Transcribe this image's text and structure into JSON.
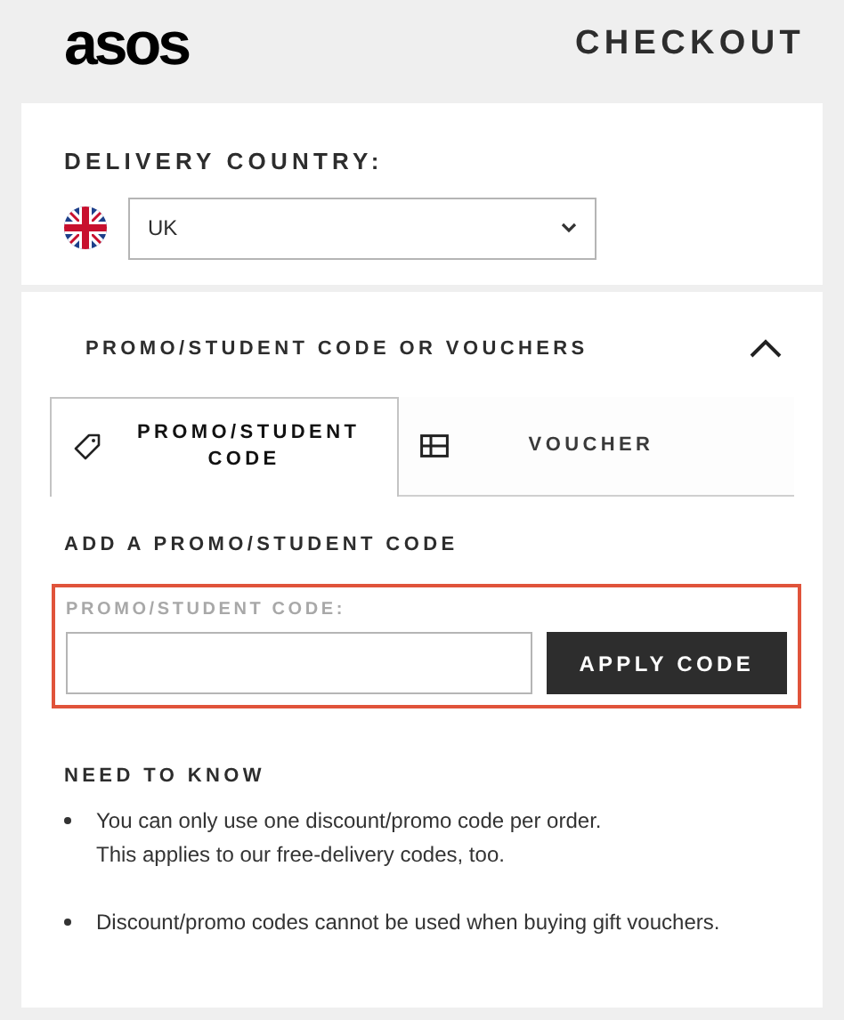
{
  "header": {
    "logo": "asos",
    "title": "CHECKOUT"
  },
  "delivery": {
    "label": "DELIVERY COUNTRY:",
    "country": "UK"
  },
  "promo": {
    "title": "PROMO/STUDENT CODE OR VOUCHERS",
    "expanded": true,
    "tabs": [
      {
        "label": "PROMO/STUDENT CODE",
        "kind": "tag",
        "selected": true
      },
      {
        "label": "VOUCHER",
        "kind": "voucher",
        "selected": false
      }
    ],
    "heading": "ADD A PROMO/STUDENT CODE",
    "field_label": "PROMO/STUDENT CODE:",
    "button": "APPLY CODE",
    "need_to_know": {
      "title": "NEED TO KNOW",
      "items": [
        {
          "lines": [
            "You can only use one discount/promo code per order.",
            "This applies to our free-delivery codes, too."
          ]
        },
        {
          "lines": [
            "Discount/promo codes cannot be used when buying gift vouchers."
          ]
        }
      ]
    }
  }
}
